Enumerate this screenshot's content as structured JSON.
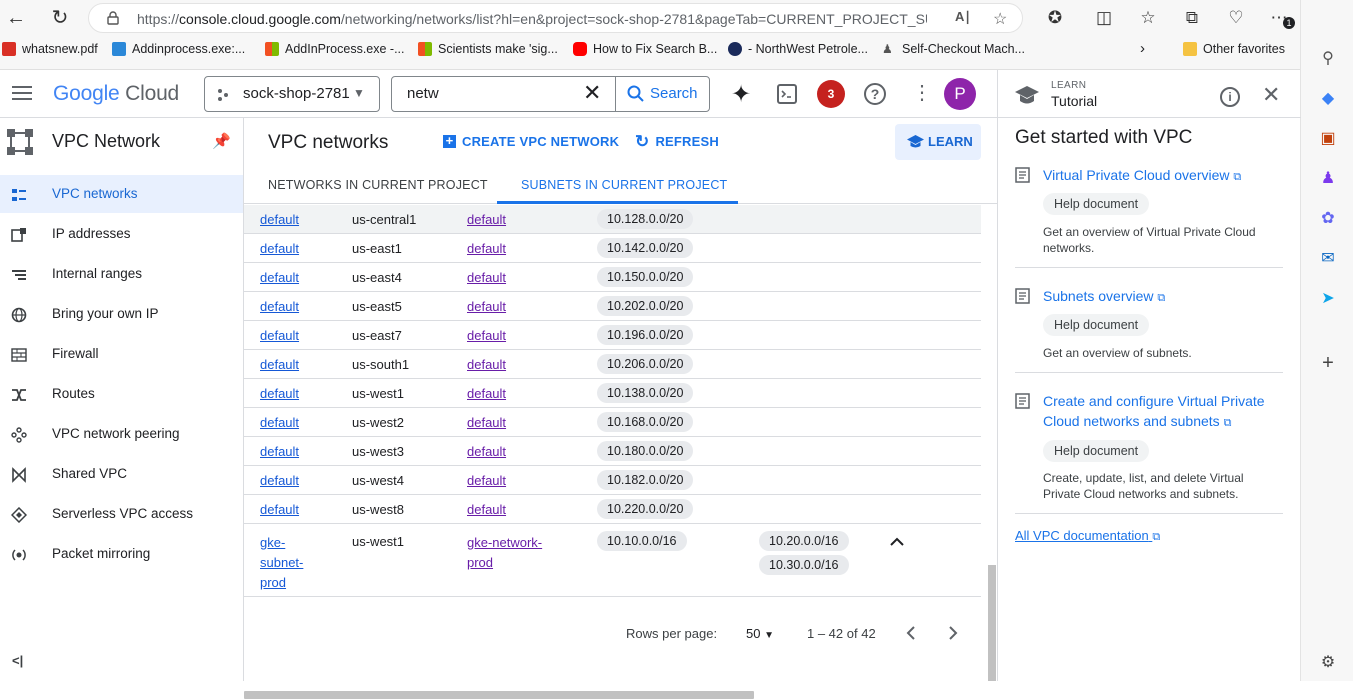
{
  "browser": {
    "url_prefix": "https://",
    "url_domain": "console.cloud.google.com",
    "url_rest": "/networking/networks/list?hl=en&project=sock-shop-2781&pageTab=CURRENT_PROJECT_SU...",
    "badge_count": "1",
    "favorites": [
      "whatsnew.pdf",
      "Addinprocess.exe:...",
      "AddInProcess.exe -...",
      "Scientists make 'sig...",
      "How to Fix Search B...",
      "- NorthWest Petrole...",
      "Self-Checkout Mach..."
    ],
    "other_favorites": "Other favorites"
  },
  "header": {
    "logo_google": "Google",
    "logo_cloud": "Cloud",
    "project": "sock-shop-2781",
    "search_value": "netw",
    "search_button": "Search",
    "notifications": "3",
    "avatar": "P"
  },
  "leftnav": {
    "title": "VPC Network",
    "items": [
      {
        "label": "VPC networks",
        "active": true
      },
      {
        "label": "IP addresses"
      },
      {
        "label": "Internal ranges"
      },
      {
        "label": "Bring your own IP"
      },
      {
        "label": "Firewall"
      },
      {
        "label": "Routes"
      },
      {
        "label": "VPC network peering"
      },
      {
        "label": "Shared VPC"
      },
      {
        "label": "Serverless VPC access"
      },
      {
        "label": "Packet mirroring"
      }
    ],
    "collapse": "<|"
  },
  "main": {
    "title": "VPC networks",
    "create_button": "CREATE VPC NETWORK",
    "refresh_button": "REFRESH",
    "learn_button": "LEARN",
    "tabs": [
      "NETWORKS IN CURRENT PROJECT",
      "SUBNETS IN CURRENT PROJECT"
    ],
    "rows": [
      {
        "name": "default",
        "region": "us-central1",
        "network": "default",
        "range": "10.128.0.0/20"
      },
      {
        "name": "default",
        "region": "us-east1",
        "network": "default",
        "range": "10.142.0.0/20"
      },
      {
        "name": "default",
        "region": "us-east4",
        "network": "default",
        "range": "10.150.0.0/20"
      },
      {
        "name": "default",
        "region": "us-east5",
        "network": "default",
        "range": "10.202.0.0/20"
      },
      {
        "name": "default",
        "region": "us-east7",
        "network": "default",
        "range": "10.196.0.0/20"
      },
      {
        "name": "default",
        "region": "us-south1",
        "network": "default",
        "range": "10.206.0.0/20"
      },
      {
        "name": "default",
        "region": "us-west1",
        "network": "default",
        "range": "10.138.0.0/20"
      },
      {
        "name": "default",
        "region": "us-west2",
        "network": "default",
        "range": "10.168.0.0/20"
      },
      {
        "name": "default",
        "region": "us-west3",
        "network": "default",
        "range": "10.180.0.0/20"
      },
      {
        "name": "default",
        "region": "us-west4",
        "network": "default",
        "range": "10.182.0.0/20"
      },
      {
        "name": "default",
        "region": "us-west8",
        "network": "default",
        "range": "10.220.0.0/20"
      }
    ],
    "last_row": {
      "name_lines": [
        "gke-",
        "subnet-",
        "prod"
      ],
      "region": "us-west1",
      "network_lines": [
        "gke-network-",
        "prod"
      ],
      "range": "10.10.0.0/16",
      "secondary": [
        "10.20.0.0/16",
        "10.30.0.0/16"
      ]
    },
    "pager": {
      "rows_label": "Rows per page:",
      "rows_value": "50",
      "range_text": "1 – 42 of 42"
    }
  },
  "panel": {
    "eyebrow": "LEARN",
    "title": "Tutorial",
    "heading": "Get started with VPC",
    "docs": [
      {
        "title": "Virtual Private Cloud overview",
        "tag": "Help document",
        "desc": "Get an overview of Virtual Private Cloud networks."
      },
      {
        "title": "Subnets overview",
        "tag": "Help document",
        "desc": "Get an overview of subnets."
      },
      {
        "title": "Create and configure Virtual Private Cloud networks and subnets",
        "tag": "Help document",
        "desc": "Create, update, list, and delete Virtual Private Cloud networks and subnets."
      }
    ],
    "all_docs": "All VPC documentation"
  },
  "colors": {
    "accent": "#1a73e8",
    "avatar": "#8e24aa",
    "notif": "#c5221f"
  }
}
